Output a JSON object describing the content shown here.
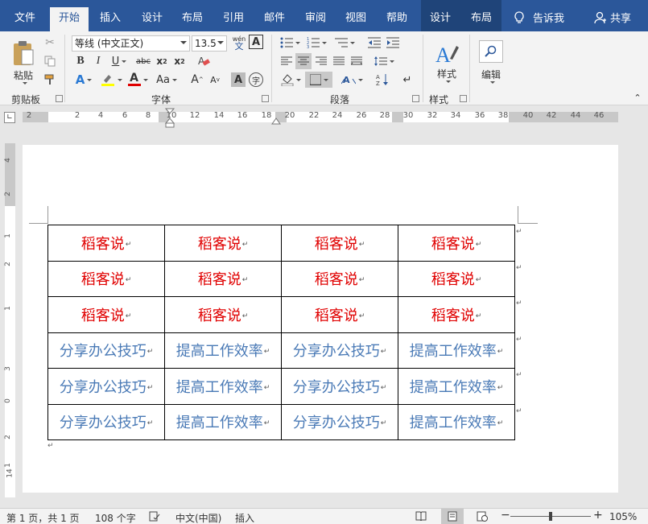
{
  "tabs": [
    {
      "label": "文件",
      "active": false
    },
    {
      "label": "开始",
      "active": true
    },
    {
      "label": "插入",
      "active": false
    },
    {
      "label": "设计",
      "active": false
    },
    {
      "label": "布局",
      "active": false
    },
    {
      "label": "引用",
      "active": false
    },
    {
      "label": "邮件",
      "active": false
    },
    {
      "label": "审阅",
      "active": false
    },
    {
      "label": "视图",
      "active": false
    },
    {
      "label": "帮助",
      "active": false
    },
    {
      "label": "设计",
      "active": false
    },
    {
      "label": "布局",
      "active": false
    }
  ],
  "tell_me": "告诉我",
  "share": "共享",
  "ribbon": {
    "clipboard": {
      "paste": "粘贴",
      "label": "剪贴板"
    },
    "font": {
      "family": "等线 (中文正文)",
      "size": "13.5",
      "wen": "wén",
      "wen_char": "文",
      "label": "字体"
    },
    "paragraph": {
      "label": "段落"
    },
    "styles": {
      "button": "样式",
      "label": "样式"
    },
    "editing": {
      "button": "编辑"
    }
  },
  "ruler_numbers": [
    "2",
    "2",
    "4",
    "6",
    "8",
    "10",
    "12",
    "14",
    "16",
    "18",
    "20",
    "22",
    "24",
    "26",
    "28",
    "30",
    "32",
    "34",
    "36",
    "38",
    "40",
    "42",
    "44",
    "46"
  ],
  "vruler_numbers": [
    "4",
    "2",
    "1",
    "2",
    "1",
    "3",
    "0",
    "2",
    "1",
    "14"
  ],
  "table": {
    "rows": [
      [
        "稻客说",
        "稻客说",
        "稻客说",
        "稻客说"
      ],
      [
        "稻客说",
        "稻客说",
        "稻客说",
        "稻客说"
      ],
      [
        "稻客说",
        "稻客说",
        "稻客说",
        "稻客说"
      ],
      [
        "分享办公技巧",
        "提高工作效率",
        "分享办公技巧",
        "提高工作效率"
      ],
      [
        "分享办公技巧",
        "提高工作效率",
        "分享办公技巧",
        "提高工作效率"
      ],
      [
        "分享办公技巧",
        "提高工作效率",
        "分享办公技巧",
        "提高工作效率"
      ]
    ],
    "mark": "↵"
  },
  "status": {
    "page": "第 1 页，共 1 页",
    "words": "108 个字",
    "language": "中文(中国)",
    "mode": "插入",
    "zoom": "105%",
    "minus": "−",
    "plus": "+"
  },
  "colors": {
    "titlebar": "#2b579a",
    "red_text": "#e00000",
    "blue_text": "#4a7ab6"
  }
}
